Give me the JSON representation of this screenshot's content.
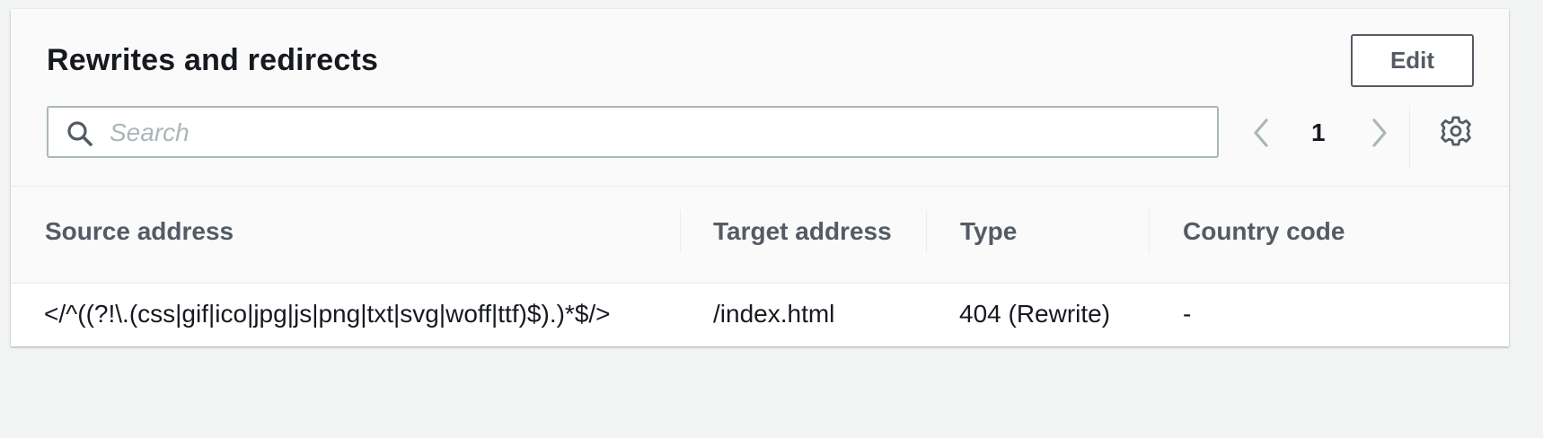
{
  "header": {
    "title": "Rewrites and redirects",
    "edit_label": "Edit"
  },
  "search": {
    "placeholder": "Search",
    "value": ""
  },
  "pagination": {
    "current_page": "1"
  },
  "icons": {
    "search": "search-icon",
    "prev": "chevron-left-icon",
    "next": "chevron-right-icon",
    "settings": "gear-icon"
  },
  "table": {
    "columns": [
      "Source address",
      "Target address",
      "Type",
      "Country code"
    ],
    "rows": [
      {
        "source": "</^((?!\\.(css|gif|ico|jpg|js|png|txt|svg|woff|ttf)$).)*$/>",
        "target": "/index.html",
        "type": "404 (Rewrite)",
        "country": "-"
      }
    ]
  },
  "colors": {
    "page_bg": "#f2f3f3",
    "panel_bg": "#fafafa",
    "row_bg": "#ffffff",
    "text": "#16191f",
    "muted_text": "#545b64",
    "border": "#aab7b8"
  }
}
